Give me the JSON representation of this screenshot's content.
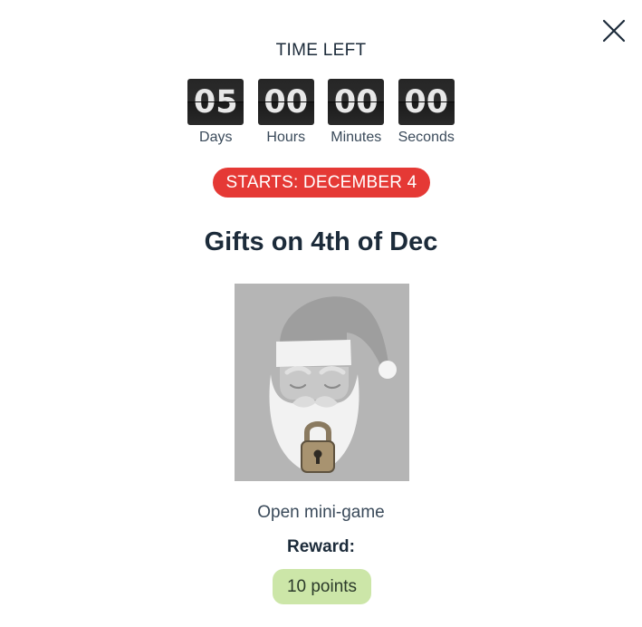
{
  "header": {
    "close_icon": "close-icon",
    "time_left_label": "TIME LEFT"
  },
  "countdown": [
    {
      "value": "05",
      "label": "Days"
    },
    {
      "value": "00",
      "label": "Hours"
    },
    {
      "value": "00",
      "label": "Minutes"
    },
    {
      "value": "00",
      "label": "Seconds"
    }
  ],
  "badge": {
    "text": "STARTS: DECEMBER 4",
    "color": "#e53935"
  },
  "title": "Gifts on 4th of Dec",
  "image": {
    "subject": "santa-claus-locked-icon",
    "lock_icon": "padlock-icon"
  },
  "action": {
    "open_label": "Open mini-game"
  },
  "reward": {
    "label": "Reward:",
    "value": "10 points",
    "color": "#cce6a8"
  }
}
